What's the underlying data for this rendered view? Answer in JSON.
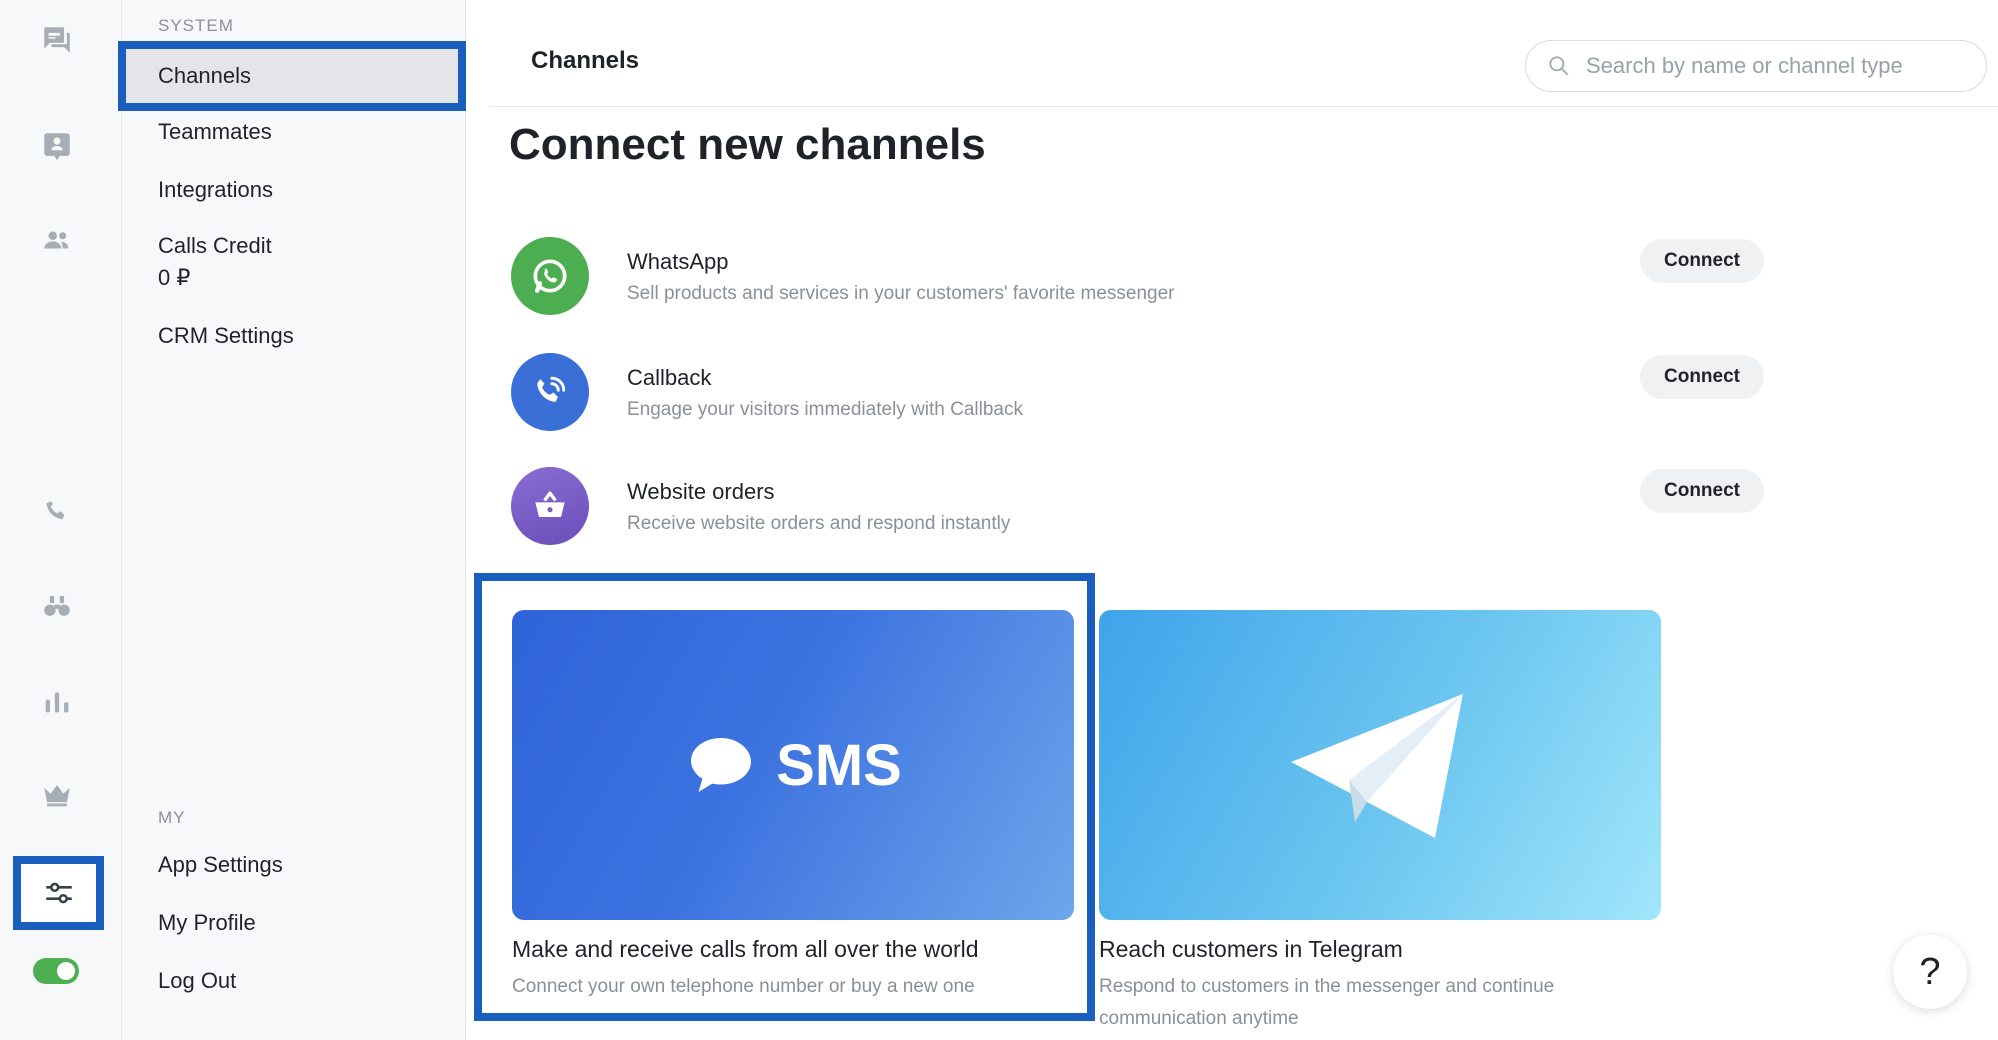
{
  "rail": {
    "icons": [
      "chat-icon",
      "contact-card-icon",
      "people-icon",
      "phone-icon",
      "binoculars-icon",
      "bar-chart-icon",
      "crown-icon",
      "sliders-icon"
    ],
    "active_icon": "sliders-icon",
    "toggle_on": true
  },
  "nav": {
    "system_heading": "SYSTEM",
    "items": [
      {
        "label": "Channels"
      },
      {
        "label": "Teammates"
      },
      {
        "label": "Integrations"
      },
      {
        "label": "Calls Credit",
        "sub": "0 ₽"
      },
      {
        "label": "CRM Settings"
      }
    ],
    "my_heading": "MY",
    "my_items": [
      {
        "label": "App Settings"
      },
      {
        "label": "My Profile"
      },
      {
        "label": "Log Out"
      }
    ]
  },
  "header": {
    "title": "Channels",
    "search_placeholder": "Search by name or channel type"
  },
  "main": {
    "title": "Connect new channels",
    "channels": [
      {
        "name": "WhatsApp",
        "description": "Sell products and services in your customers' favorite messenger",
        "button": "Connect",
        "icon": "whatsapp-icon",
        "color": "#4cae50"
      },
      {
        "name": "Callback",
        "description": "Engage your visitors immediately with Callback",
        "button": "Connect",
        "icon": "phone-callback-icon",
        "color": "#3a6fd8"
      },
      {
        "name": "Website orders",
        "description": "Receive website orders and respond instantly",
        "button": "Connect",
        "icon": "shopping-basket-icon",
        "color": "#7b5cc4"
      }
    ],
    "cards": [
      {
        "banner_label": "SMS",
        "title": "Make and receive calls from all over the world",
        "description": "Connect your own telephone number or buy a new one"
      },
      {
        "banner_label": "",
        "title": "Reach customers in Telegram",
        "description": "Respond to customers in the messenger and continue communication anytime"
      }
    ]
  },
  "help": {
    "label": "?"
  },
  "colors": {
    "accent": "#1a5fbe",
    "toggle": "#4caf50"
  }
}
